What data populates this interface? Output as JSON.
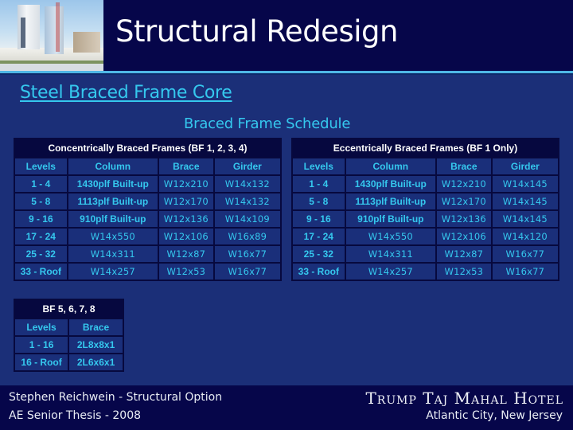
{
  "header": {
    "title": "Structural Redesign",
    "photo": "hotel-building-photo"
  },
  "subtitle": "Steel Braced Frame Core",
  "schedule_title": "Braced Frame Schedule",
  "concentric_table": {
    "caption": "Concentrically Braced Frames (BF 1, 2, 3, 4)",
    "columns": [
      "Levels",
      "Column",
      "Brace",
      "Girder"
    ],
    "rows": [
      [
        "1 - 4",
        "1430plf Built-up",
        "W12x210",
        "W14x132"
      ],
      [
        "5 - 8",
        "1113plf Built-up",
        "W12x170",
        "W14x132"
      ],
      [
        "9 - 16",
        "910plf Built-up",
        "W12x136",
        "W14x109"
      ],
      [
        "17 - 24",
        "W14x550",
        "W12x106",
        "W16x89"
      ],
      [
        "25 - 32",
        "W14x311",
        "W12x87",
        "W16x77"
      ],
      [
        "33 - Roof",
        "W14x257",
        "W12x53",
        "W16x77"
      ]
    ]
  },
  "eccentric_table": {
    "caption": "Eccentrically Braced Frames (BF 1 Only)",
    "columns": [
      "Levels",
      "Column",
      "Brace",
      "Girder"
    ],
    "rows": [
      [
        "1 - 4",
        "1430plf Built-up",
        "W12x210",
        "W14x145"
      ],
      [
        "5 - 8",
        "1113plf Built-up",
        "W12x170",
        "W14x145"
      ],
      [
        "9 - 16",
        "910plf Built-up",
        "W12x136",
        "W14x145"
      ],
      [
        "17 - 24",
        "W14x550",
        "W12x106",
        "W14x120"
      ],
      [
        "25 - 32",
        "W14x311",
        "W12x87",
        "W16x77"
      ],
      [
        "33 - Roof",
        "W14x257",
        "W12x53",
        "W16x77"
      ]
    ]
  },
  "bf_small_table": {
    "caption": "BF 5, 6, 7, 8",
    "columns": [
      "Levels",
      "Brace"
    ],
    "rows": [
      [
        "1 - 16",
        "2L8x8x1"
      ],
      [
        "16 - Roof",
        "2L6x6x1"
      ]
    ]
  },
  "footer": {
    "author": "Stephen Reichwein - Structural Option",
    "thesis": "AE Senior Thesis - 2008",
    "hotel": "Trump Taj Mahal Hotel",
    "location": "Atlantic City, New Jersey"
  },
  "colors": {
    "background": "#1b2f78",
    "header_bg": "#06064a",
    "accent_cyan": "#35c8ee",
    "header_line": "#4fb7e6",
    "table_caption_bg": "#06083f",
    "table_border": "#07093e"
  }
}
